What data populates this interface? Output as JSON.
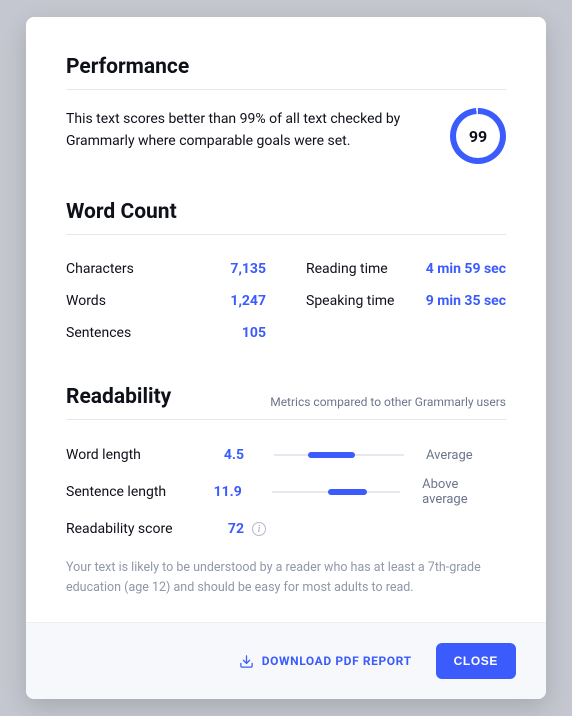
{
  "performance": {
    "title": "Performance",
    "description": "This text scores better than 99% of all text checked by Grammarly where comparable goals were set.",
    "score": "99"
  },
  "wordcount": {
    "title": "Word Count",
    "left": [
      {
        "label": "Characters",
        "value": "7,135"
      },
      {
        "label": "Words",
        "value": "1,247"
      },
      {
        "label": "Sentences",
        "value": "105"
      }
    ],
    "right": [
      {
        "label": "Reading time",
        "value": "4 min 59 sec"
      },
      {
        "label": "Speaking time",
        "value": "9 min 35 sec"
      }
    ]
  },
  "readability": {
    "title": "Readability",
    "subtitle": "Metrics compared to other Grammarly users",
    "metrics": [
      {
        "label": "Word length",
        "value": "4.5",
        "tag": "Average"
      },
      {
        "label": "Sentence length",
        "value": "11.9",
        "tag": "Above average"
      }
    ],
    "score_label": "Readability score",
    "score_value": "72",
    "explanation": "Your text is likely to be understood by a reader who has at least a 7th-grade education (age 12) and should be easy for most adults to read."
  },
  "footer": {
    "download": "DOWNLOAD PDF REPORT",
    "close": "CLOSE"
  }
}
